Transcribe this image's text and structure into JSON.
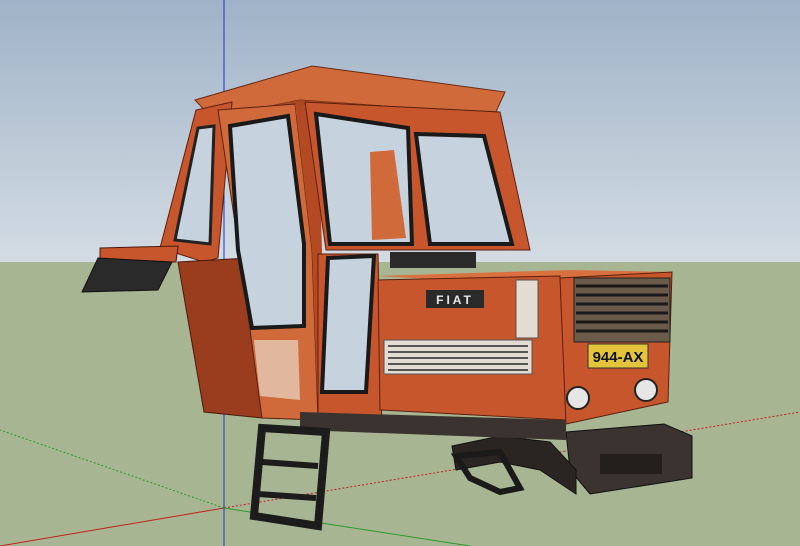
{
  "scene": {
    "model_name": "fiat-tractor-cab",
    "brand_badge": "FIAT",
    "license_plate": "944-AX",
    "colors": {
      "sky_top": "#9fb2c7",
      "sky_bottom": "#d3dbe3",
      "ground": "#a8b592",
      "body_orange": "#c8562c",
      "body_orange_light": "#d9703f",
      "glass": "#c6d3de",
      "plate_yellow": "#e3c43a",
      "axis_red": "#c02020",
      "axis_green": "#2a9a2a",
      "axis_blue": "#2030c8"
    }
  }
}
